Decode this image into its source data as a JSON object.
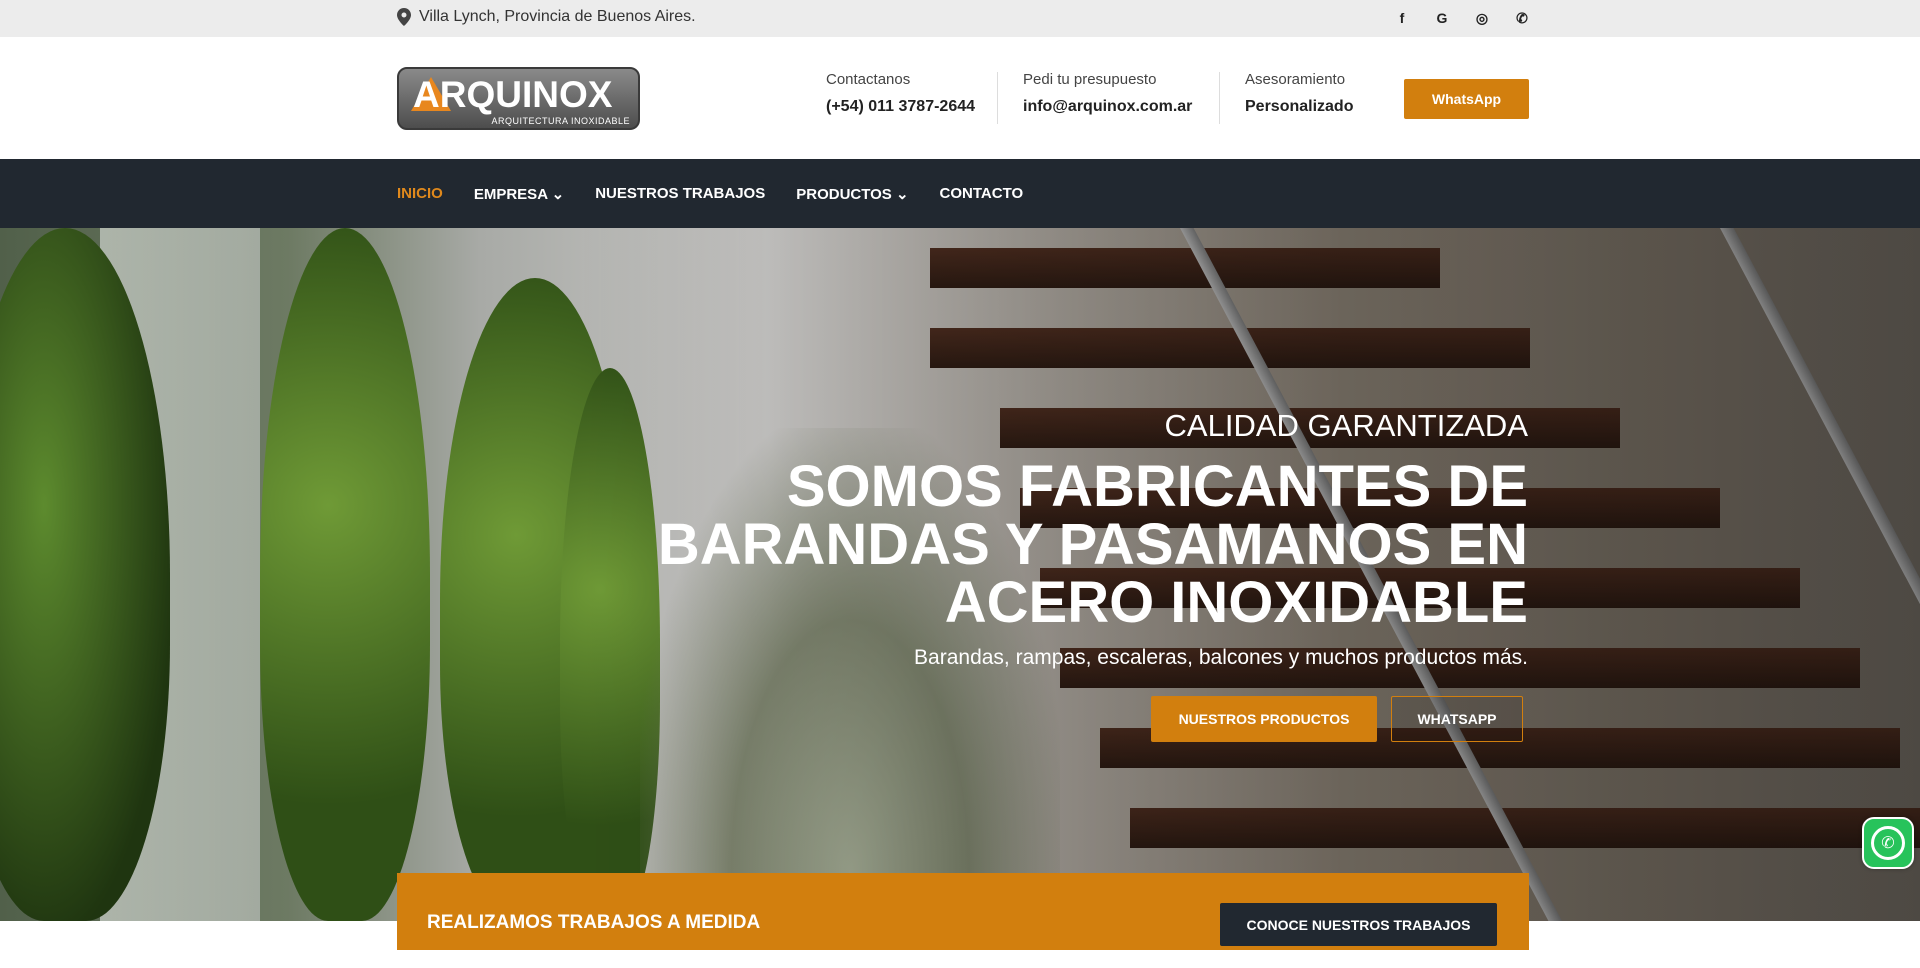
{
  "topbar": {
    "location_icon": "map-pin-icon",
    "location": "Villa Lynch, Provincia de Buenos Aires.",
    "social": [
      {
        "name": "facebook-icon",
        "glyph": "f"
      },
      {
        "name": "google-icon",
        "glyph": "G"
      },
      {
        "name": "instagram-icon",
        "glyph": "◎"
      },
      {
        "name": "whatsapp-icon",
        "glyph": "✆"
      }
    ]
  },
  "header": {
    "logo_text": "ARQUINOX",
    "logo_sub": "ARQUITECTURA INOXIDABLE",
    "contact": {
      "label": "Contactanos",
      "value": "(+54) 011 3787-2644"
    },
    "quote": {
      "label": "Pedi tu presupuesto",
      "value": "info@arquinox.com.ar"
    },
    "advice": {
      "label": "Asesoramiento",
      "value": "Personalizado"
    },
    "whatsapp_button": "WhatsApp"
  },
  "nav": {
    "items": [
      "INICIO",
      "EMPRESA ⌄",
      "NUESTROS TRABAJOS",
      "PRODUCTOS ⌄",
      "CONTACTO"
    ]
  },
  "hero": {
    "kicker": "CALIDAD GARANTIZADA",
    "title": "SOMOS FABRICANTES DE BARANDAS Y PASAMANOS EN ACERO INOXIDABLE",
    "description": "Barandas, rampas, escaleras, balcones y muchos productos más.",
    "primary_button": "NUESTROS PRODUCTOS",
    "secondary_button": "WHATSAPP"
  },
  "band": {
    "text": "REALIZAMOS TRABAJOS A MEDIDA",
    "button": "CONOCE NUESTROS TRABAJOS"
  },
  "colors": {
    "accent": "#d27f0e",
    "dark": "#212830",
    "topbar": "#ececec"
  }
}
